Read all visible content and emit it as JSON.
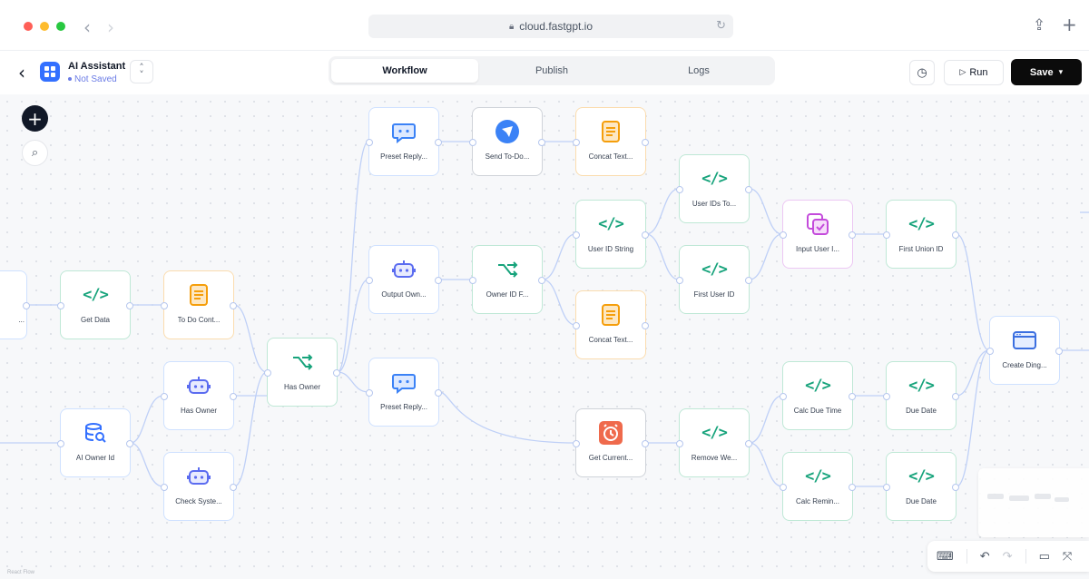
{
  "browser": {
    "url": "cloud.fastgpt.io",
    "back_icon": "chevron-left-icon",
    "forward_icon": "chevron-right-icon"
  },
  "header": {
    "app_name": "AI Assistant",
    "status": "Not Saved",
    "tabs": [
      {
        "label": "Workflow",
        "active": true
      },
      {
        "label": "Publish",
        "active": false
      },
      {
        "label": "Logs",
        "active": false
      }
    ],
    "run_label": "Run",
    "save_label": "Save"
  },
  "canvas": {
    "footer_note": "React Flow",
    "nodes": [
      {
        "id": "n0",
        "label": "...",
        "icon": "partial-node",
        "color": "blue"
      },
      {
        "id": "get-data",
        "label": "Get Data",
        "icon": "code-icon",
        "color": "green"
      },
      {
        "id": "to-do-cont",
        "label": "To Do Cont...",
        "icon": "text-doc-icon",
        "color": "orange"
      },
      {
        "id": "ai-owner-id",
        "label": "AI Owner Id",
        "icon": "database-search-icon",
        "color": "blue"
      },
      {
        "id": "has-owner-bot",
        "label": "Has Owner",
        "icon": "bot-icon",
        "color": "blue"
      },
      {
        "id": "check-syste",
        "label": "Check Syste...",
        "icon": "bot-icon",
        "color": "blue"
      },
      {
        "id": "has-owner-branch",
        "label": "Has Owner",
        "icon": "branch-icon",
        "color": "green"
      },
      {
        "id": "preset-reply-1",
        "label": "Preset Reply...",
        "icon": "chat-bot-icon",
        "color": "blue"
      },
      {
        "id": "output-own",
        "label": "Output Own...",
        "icon": "bot-icon",
        "color": "blue"
      },
      {
        "id": "preset-reply-2",
        "label": "Preset Reply...",
        "icon": "chat-bot-icon",
        "color": "blue"
      },
      {
        "id": "send-to-do",
        "label": "Send To-Do...",
        "icon": "send-icon",
        "color": "gray"
      },
      {
        "id": "owner-id-f",
        "label": "Owner ID F...",
        "icon": "branch-icon",
        "color": "green"
      },
      {
        "id": "concat-text-1",
        "label": "Concat Text...",
        "icon": "text-doc-icon",
        "color": "orange"
      },
      {
        "id": "user-id-string",
        "label": "User ID String",
        "icon": "code-icon",
        "color": "green"
      },
      {
        "id": "concat-text-2",
        "label": "Concat Text...",
        "icon": "text-doc-icon",
        "color": "orange"
      },
      {
        "id": "get-current",
        "label": "Get Current...",
        "icon": "alarm-icon",
        "color": "gray"
      },
      {
        "id": "user-ids-to",
        "label": "User IDs To...",
        "icon": "code-icon",
        "color": "green"
      },
      {
        "id": "first-user-id",
        "label": "First User ID",
        "icon": "code-icon",
        "color": "green"
      },
      {
        "id": "remove-we",
        "label": "Remove We...",
        "icon": "code-icon",
        "color": "green"
      },
      {
        "id": "input-user",
        "label": "Input User I...",
        "icon": "form-check-icon",
        "color": "purple"
      },
      {
        "id": "calc-due-time",
        "label": "Calc Due Time",
        "icon": "code-icon",
        "color": "green"
      },
      {
        "id": "calc-remin",
        "label": "Calc Remin...",
        "icon": "code-icon",
        "color": "green"
      },
      {
        "id": "first-union-id",
        "label": "First Union ID",
        "icon": "code-icon",
        "color": "green"
      },
      {
        "id": "due-date-1",
        "label": "Due Date",
        "icon": "code-icon",
        "color": "green"
      },
      {
        "id": "due-date-2",
        "label": "Due Date",
        "icon": "code-icon",
        "color": "green"
      },
      {
        "id": "create-ding",
        "label": "Create Ding...",
        "icon": "window-icon",
        "color": "blue"
      }
    ]
  },
  "colors": {
    "accent": "#3370ff",
    "code": "#16a37b",
    "text_node": "#f59e0b",
    "bot": "#5b6cf0",
    "form": "#c44bdb",
    "alarm": "#ef6a4c",
    "edge": "#bfd0f7"
  }
}
